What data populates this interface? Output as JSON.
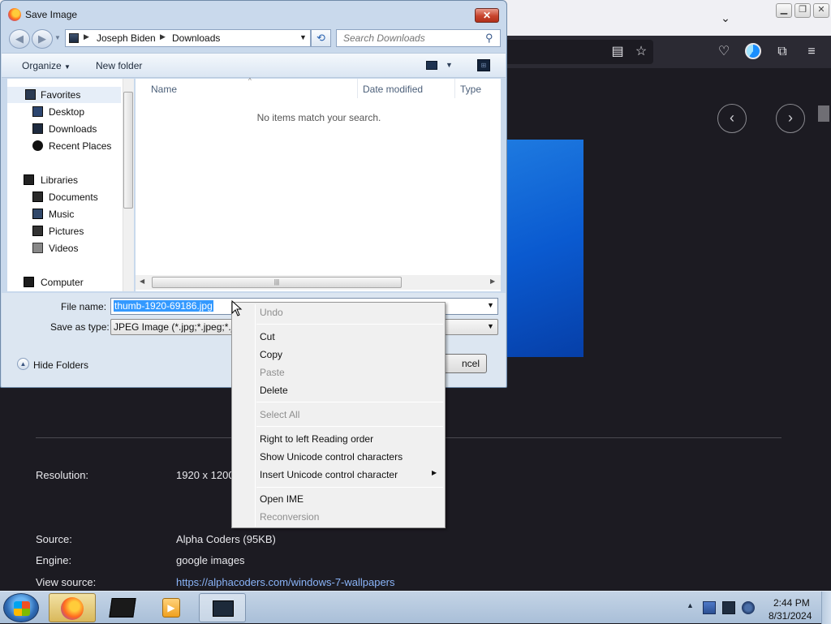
{
  "dialog": {
    "title": "Save Image",
    "close_label": "✕",
    "breadcrumb": [
      "Joseph Biden",
      "Downloads"
    ],
    "search_placeholder": "Search Downloads",
    "toolbar": {
      "organize": "Organize",
      "new_folder": "New folder"
    },
    "nav": {
      "favorites": "Favorites",
      "desktop": "Desktop",
      "downloads": "Downloads",
      "recent_places": "Recent Places",
      "libraries": "Libraries",
      "documents": "Documents",
      "music": "Music",
      "pictures": "Pictures",
      "videos": "Videos",
      "computer": "Computer"
    },
    "columns": {
      "name": "Name",
      "date_modified": "Date modified",
      "type": "Type"
    },
    "empty_message": "No items match your search.",
    "file_name_label": "File name:",
    "file_name_value": "thumb-1920-69186.jpg",
    "save_type_label": "Save as type:",
    "save_type_value": "JPEG Image (*.jpg;*.jpeg;*.jfi",
    "hide_folders": "Hide Folders",
    "cancel": "ncel"
  },
  "context_menu": {
    "undo": "Undo",
    "cut": "Cut",
    "copy": "Copy",
    "paste": "Paste",
    "delete": "Delete",
    "select_all": "Select All",
    "rtl": "Right to left Reading order",
    "show_unicode": "Show Unicode control characters",
    "insert_unicode": "Insert Unicode control character",
    "open_ime": "Open IME",
    "reconversion": "Reconversion"
  },
  "page": {
    "resolution_label": "Resolution:",
    "resolution_value": "1920 x 1200",
    "source_label": "Source:",
    "source_value": "Alpha Coders (95KB)",
    "engine_label": "Engine:",
    "engine_value": "google images",
    "view_source_label": "View source:",
    "view_source_link": "https://alphacoders.com/windows-7-wallpapers"
  },
  "taskbar": {
    "time": "2:44 PM",
    "date": "8/31/2024"
  },
  "colors": {
    "selection": "#3399ff",
    "link": "#8ab4f8",
    "browser_bg": "#1c1b22"
  }
}
